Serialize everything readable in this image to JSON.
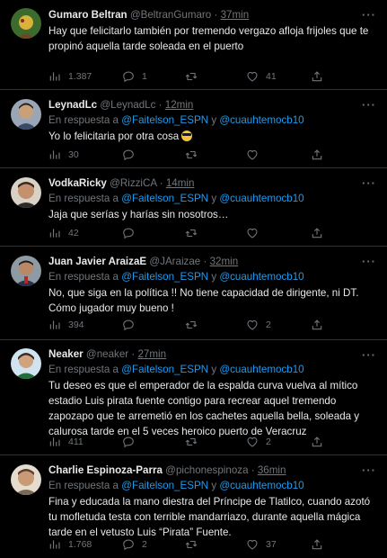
{
  "reply_prefix": "En respuesta a",
  "reply_and": "y",
  "mention_1": "@Faitelson_ESPN",
  "mention_2": "@cuauhtemocb10",
  "more_glyph": "···",
  "icons": {
    "views": "bar-chart-icon",
    "reply": "speech-bubble-icon",
    "retweet": "retweet-arrows-icon",
    "like": "heart-icon",
    "share": "share-upload-icon"
  },
  "colors": {
    "background": "#000000",
    "text": "#e7e9ea",
    "muted": "#71767b",
    "mention": "#1d9bf0",
    "divider": "#2f3336"
  },
  "tweets": [
    {
      "name": "Gumaro Beltran",
      "handle": "@BeltranGumaro",
      "sep": "·",
      "time": "37min",
      "text": "Hay que felicitarlo también por tremendo vergazo afloja frijoles que te propinó aquella tarde soleada en el puerto",
      "views": "1.387",
      "replies": "1",
      "retweets": "",
      "likes": "41"
    },
    {
      "name": "LeynadLc",
      "handle": "@LeynadLc",
      "sep": "·",
      "time": "12min",
      "text": "Yo lo felicitaria por otra cosa",
      "views": "30",
      "replies": "",
      "retweets": "",
      "likes": ""
    },
    {
      "name": "VodkaRicky",
      "handle": "@RizziCA",
      "sep": "·",
      "time": "14min",
      "text": "Jaja que serías y harías sin nosotros…",
      "views": "42",
      "replies": "",
      "retweets": "",
      "likes": ""
    },
    {
      "name": "Juan Javier AraizaE",
      "handle": "@JAraizae",
      "sep": "·",
      "time": "32min",
      "text": "No, que siga en la política !! No tiene capacidad de dirigente, ni DT. Cómo jugador muy bueno !",
      "views": "394",
      "replies": "",
      "retweets": "",
      "likes": "2"
    },
    {
      "name": "Neaker",
      "handle": "@neaker",
      "sep": "·",
      "time": "27min",
      "text": "Tu deseo es que el emperador de la espalda curva vuelva al mítico estadio Luis  pirata fuente contigo para recrear aquel tremendo zapozapo que te arremetió en los cachetes aquella bella, soleada y calurosa tarde en el 5 veces heroico puerto de Veracruz",
      "views": "411",
      "replies": "",
      "retweets": "",
      "likes": "2"
    },
    {
      "name": "Charlie Espinoza-Parra",
      "handle": "@pichonespinoza",
      "sep": "·",
      "time": "36min",
      "text": "Fina y educada la mano diestra del Príncipe de Tlatilco, cuando azotó tu mofletuda testa con terrible mandarriazo, durante aquella mágica tarde en el vetusto Luis “Pirata” Fuente.",
      "views": "1.768",
      "replies": "2",
      "retweets": "",
      "likes": "37"
    }
  ]
}
